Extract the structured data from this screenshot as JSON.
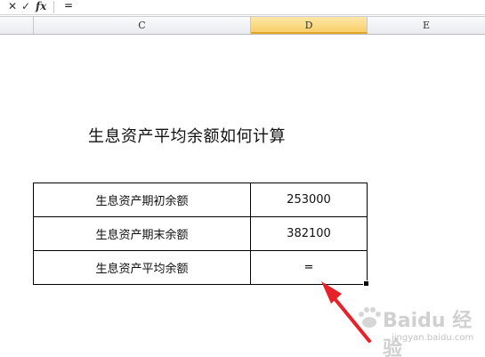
{
  "formula_bar": {
    "cancel_icon": "✕",
    "enter_icon": "✓",
    "fx_label": "fx",
    "input_value": "="
  },
  "columns": {
    "c": "C",
    "d": "D",
    "e": "E",
    "selected": "D"
  },
  "sheet": {
    "title": "生息资产平均余额如何计算",
    "rows": [
      {
        "label": "生息资产期初余额",
        "value": "253000"
      },
      {
        "label": "生息资产期末余额",
        "value": "382100"
      },
      {
        "label": "生息资产平均余额",
        "value": "="
      }
    ]
  },
  "annotation": {
    "arrow_color": "#e8202a"
  },
  "watermark": {
    "text": "Baidu 经验",
    "url": "jingyan.baidu.com"
  }
}
